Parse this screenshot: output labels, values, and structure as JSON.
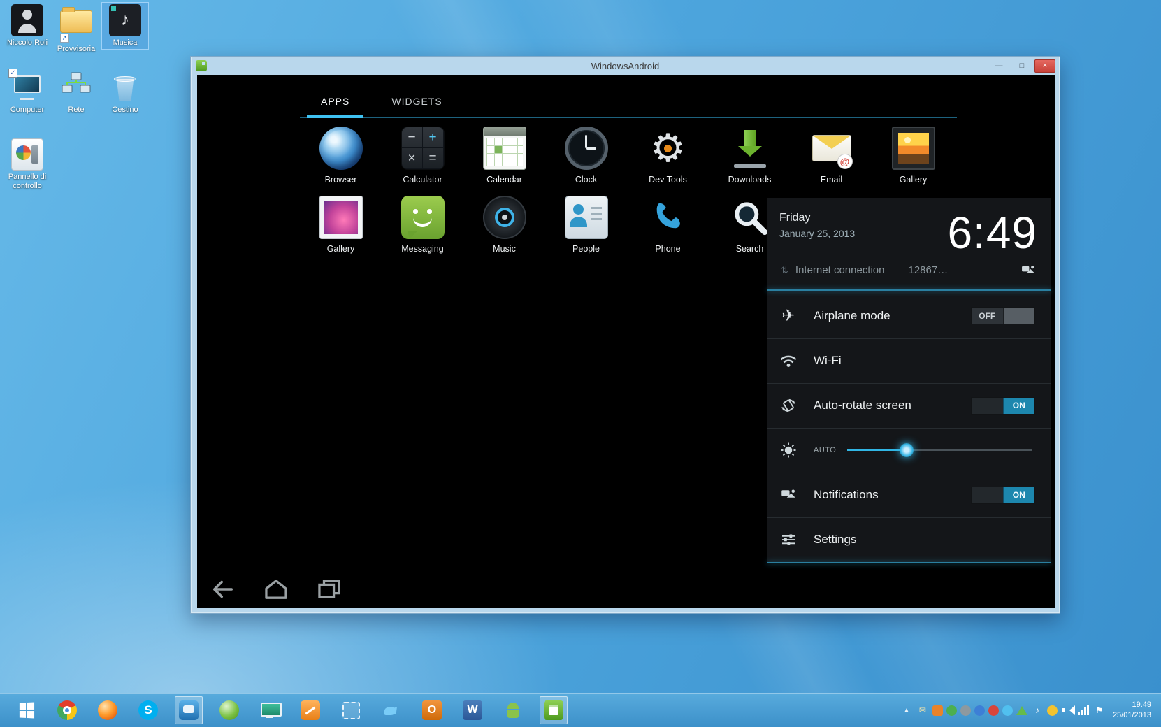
{
  "colors": {
    "holo_blue": "#33b5e5",
    "toggle_on": "#1d87ae",
    "titlebar": "#b9d7ec",
    "taskbar": "#4296ce",
    "close_red": "#d9544f",
    "wallpaper": "#4da5dd"
  },
  "desktop": {
    "icons": [
      {
        "label": "Niccolo Roli"
      },
      {
        "label": "Provvisoria"
      },
      {
        "label": "Musica"
      },
      {
        "label": "Computer"
      },
      {
        "label": "Rete"
      },
      {
        "label": "Cestino"
      },
      {
        "label": "Pannello di controllo"
      }
    ]
  },
  "window": {
    "title": "WindowsAndroid",
    "controls": {
      "minimize": "—",
      "maximize": "□",
      "close": "×"
    },
    "tabs": {
      "apps": "APPS",
      "widgets": "WIDGETS"
    },
    "apps": [
      "Browser",
      "Calculator",
      "Calendar",
      "Clock",
      "Dev Tools",
      "Downloads",
      "Email",
      "Gallery",
      "Gallery",
      "Messaging",
      "Music",
      "People",
      "Phone",
      "Search"
    ],
    "quick_settings": {
      "day": "Friday",
      "date": "January 25, 2013",
      "time": "6:49",
      "status_label": "Internet connection",
      "status_value": "12867…",
      "airplane_label": "Airplane mode",
      "airplane_state": "OFF",
      "wifi_label": "Wi-Fi",
      "rotate_label": "Auto-rotate screen",
      "rotate_state": "ON",
      "brightness_label": "AUTO",
      "notifications_label": "Notifications",
      "notifications_state": "ON",
      "settings_label": "Settings"
    }
  },
  "taskbar": {
    "clock_time": "19.49",
    "clock_date": "25/01/2013"
  },
  "glyphs": {
    "at": "@",
    "updown": "⇅",
    "airplane": "✈",
    "gear": "⚙",
    "note": "♪",
    "mail": "✉",
    "flag": "⚑",
    "skype": "S",
    "outlook": "O",
    "word": "W",
    "calc": [
      "−",
      "+",
      "×",
      "="
    ]
  }
}
